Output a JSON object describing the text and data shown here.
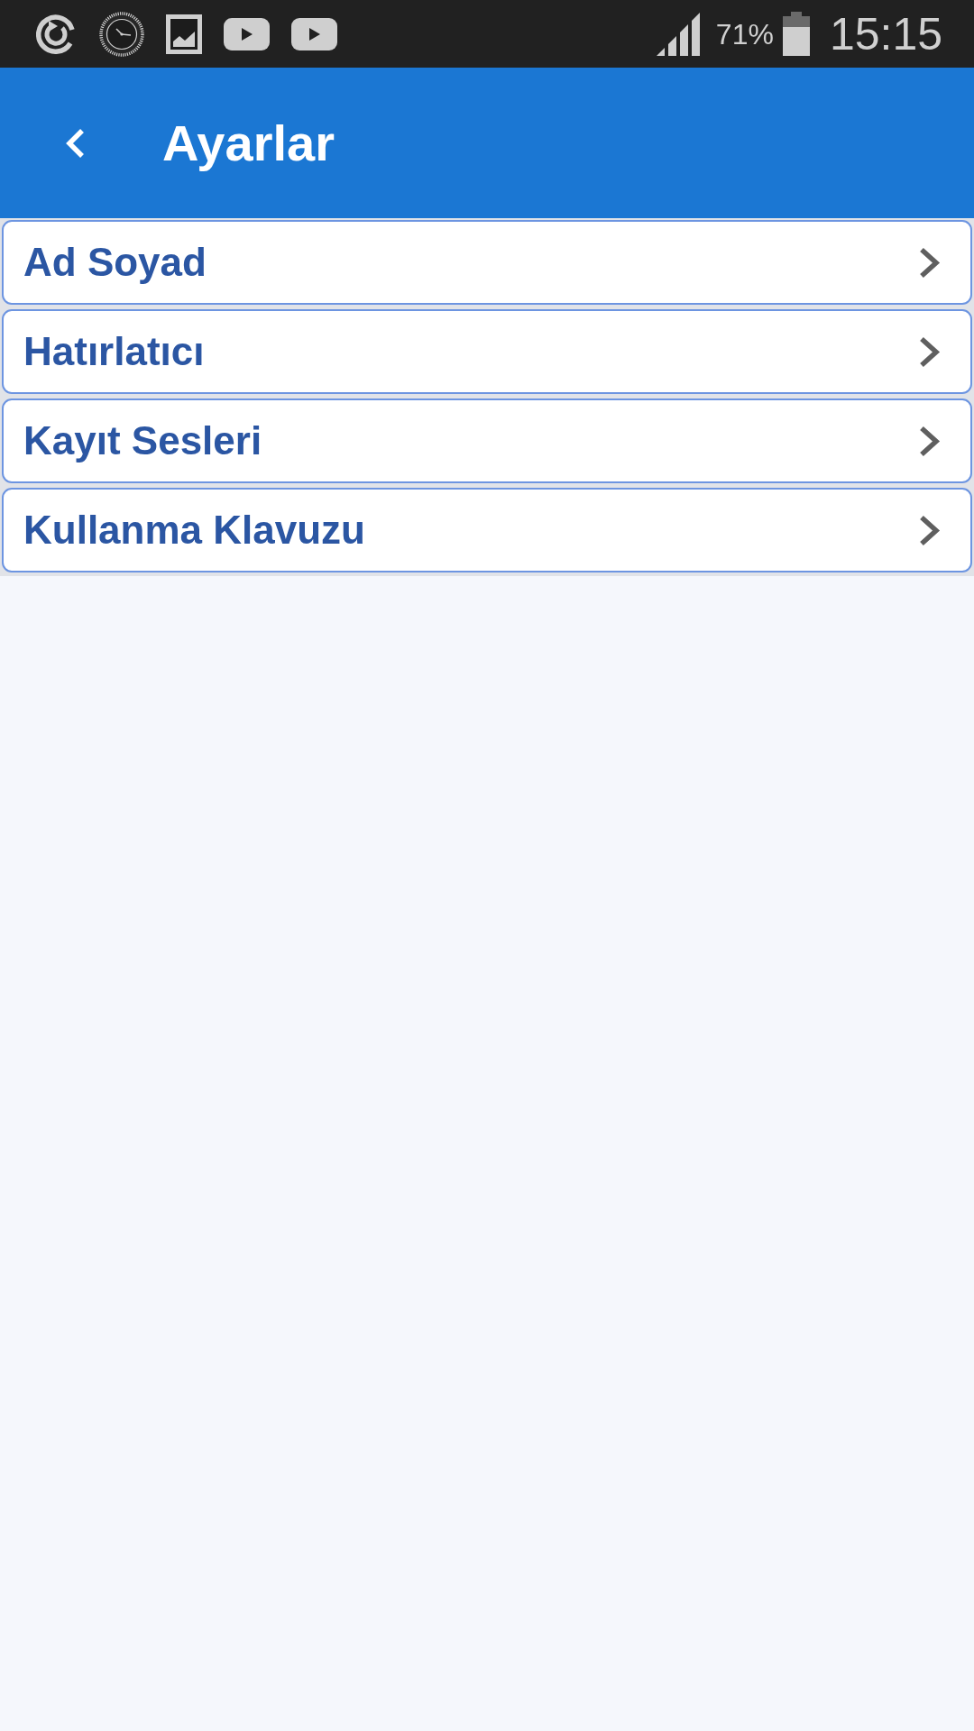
{
  "status_bar": {
    "battery_percent": "71%",
    "time": "15:15"
  },
  "app_bar": {
    "title": "Ayarlar"
  },
  "settings_items": [
    {
      "label": "Ad Soyad"
    },
    {
      "label": "Hatırlatıcı"
    },
    {
      "label": "Kayıt Sesleri"
    },
    {
      "label": "Kullanma Klavuzu"
    }
  ]
}
